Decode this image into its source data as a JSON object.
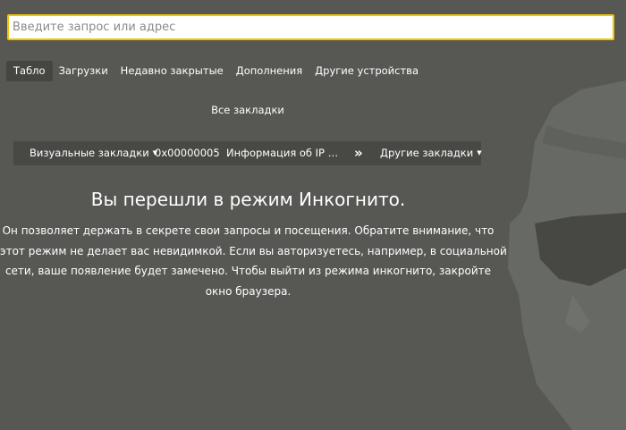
{
  "search": {
    "placeholder": "Введите запрос или адрес",
    "value": ""
  },
  "tabs": [
    {
      "label": "Табло",
      "active": true
    },
    {
      "label": "Загрузки",
      "active": false
    },
    {
      "label": "Недавно закрытые",
      "active": false
    },
    {
      "label": "Дополнения",
      "active": false
    },
    {
      "label": "Другие устройства",
      "active": false
    }
  ],
  "all_bookmarks_label": "Все закладки",
  "bookmarks_bar": {
    "items": [
      {
        "label": "Визуальные закладки",
        "has_dropdown": true
      },
      {
        "label": "0x00000005",
        "has_dropdown": false
      },
      {
        "label": "Информация об IP ад...",
        "has_dropdown": false
      }
    ],
    "overflow_label": "»",
    "other_label": "Другие закладки"
  },
  "incognito": {
    "title": "Вы перешли в режим Инкогнито.",
    "lines": [
      "Он позволяет держать в секрете свои запросы и посещения. Обратите внимание, что",
      "этот режим не делает вас невидимкой. Если вы авторизуетесь, например, в социальной",
      "сети, ваше появление будет замечено. Чтобы выйти из режима инкогнито, закройте",
      "окно браузера."
    ]
  },
  "colors": {
    "background": "#575854",
    "search_border": "#f6c400",
    "bar_background": "#484945",
    "active_tab": "#454642",
    "figure": "#676964"
  },
  "icons": {
    "background_figure": "incognito-spy-figure",
    "dropdown": "caret-down-icon",
    "overflow": "double-chevron-right-icon"
  }
}
